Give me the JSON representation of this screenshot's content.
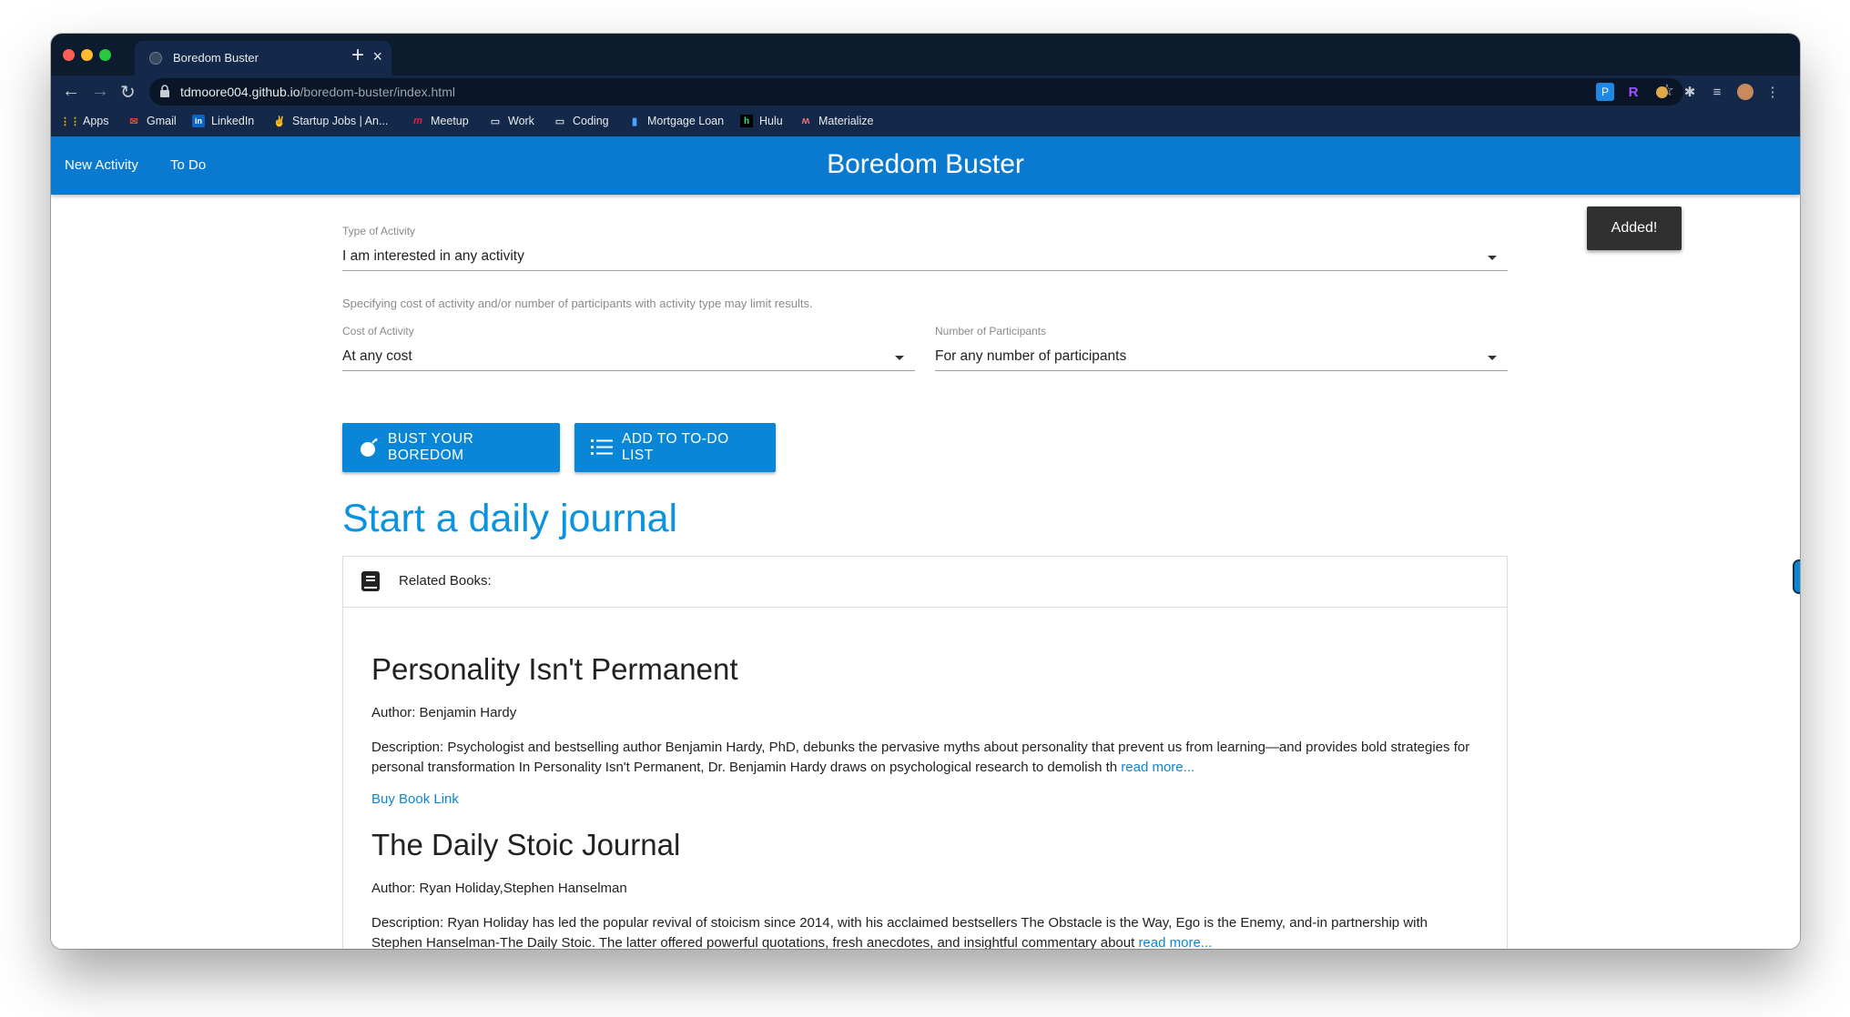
{
  "browser": {
    "tab_title": "Boredom Buster",
    "url_host": "tdmoore004.github.io",
    "url_path": "/boredom-buster/index.html"
  },
  "bookmarks": [
    {
      "label": "Apps",
      "icon": "apps-grid-icon"
    },
    {
      "label": "Gmail",
      "icon": "gmail-icon"
    },
    {
      "label": "LinkedIn",
      "icon": "linkedin-icon"
    },
    {
      "label": "Startup Jobs | An...",
      "icon": "angellist-icon"
    },
    {
      "label": "Meetup",
      "icon": "meetup-icon"
    },
    {
      "label": "Work",
      "icon": "folder-icon"
    },
    {
      "label": "Coding",
      "icon": "folder-icon"
    },
    {
      "label": "Mortgage Loan",
      "icon": "bookmark-page-icon"
    },
    {
      "label": "Hulu",
      "icon": "hulu-icon"
    },
    {
      "label": "Materialize",
      "icon": "materialize-icon"
    }
  ],
  "app": {
    "nav_new_activity": "New Activity",
    "nav_todo": "To Do",
    "brand": "Boredom Buster"
  },
  "form": {
    "type_label": "Type of Activity",
    "type_value": "I am interested in any activity",
    "hint": "Specifying cost of activity and/or number of participants with activity type may limit results.",
    "cost_label": "Cost of Activity",
    "cost_value": "At any cost",
    "participants_label": "Number of Participants",
    "participants_value": "For any number of participants"
  },
  "buttons": {
    "bust": "BUST YOUR BOREDOM",
    "add_todo": "ADD TO TO-DO LIST"
  },
  "toast": "Added!",
  "activity": {
    "title": "Start a daily journal",
    "related_label": "Related Books:",
    "books": [
      {
        "title": "Personality Isn't Permanent",
        "author": "Author: Benjamin Hardy",
        "description": "Description: Psychologist and bestselling author Benjamin Hardy, PhD, debunks the pervasive myths about personality that prevent us from learning—and provides bold strategies for personal transformation In Personality Isn't Permanent, Dr. Benjamin Hardy draws on psychological research to demolish th ",
        "read_more": "read more...",
        "buy_link": "Buy Book Link"
      },
      {
        "title": "The Daily Stoic Journal",
        "author": "Author: Ryan Holiday,Stephen Hanselman",
        "description": "Description: Ryan Holiday has led the popular revival of stoicism since 2014, with his acclaimed bestsellers The Obstacle is the Way, Ego is the Enemy, and-in partnership with Stephen Hanselman-The Daily Stoic. The latter offered powerful quotations, fresh anecdotes, and insightful commentary about ",
        "read_more": "read more..."
      }
    ]
  },
  "colors": {
    "appbar": "#0a7ad0",
    "accent": "#0a86d9",
    "heading": "#0a94e0",
    "browser_frame": "#0d1b2e"
  }
}
